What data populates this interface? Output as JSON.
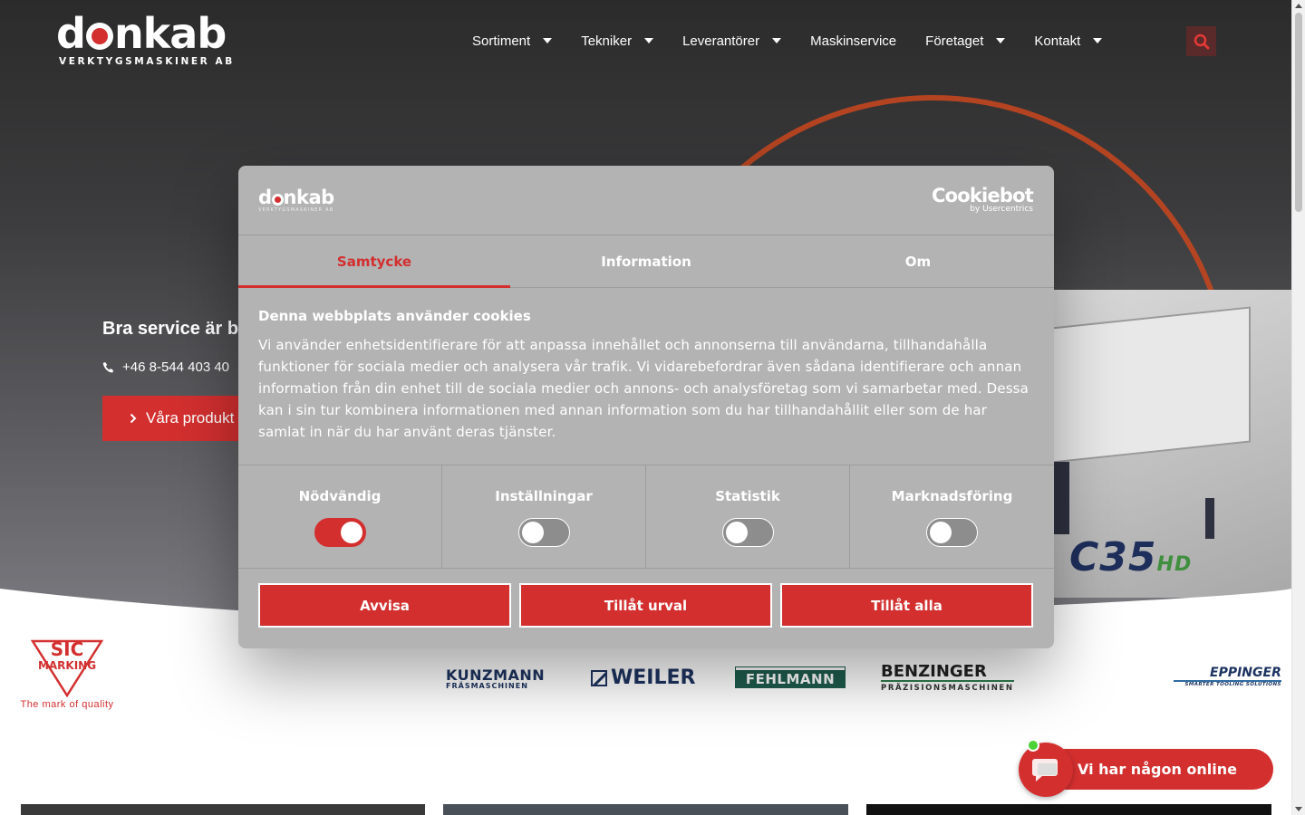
{
  "header": {
    "logo_word_1": "d",
    "logo_word_2": "nkab",
    "logo_subtitle": "VERKTYGSMASKINER AB",
    "nav": [
      {
        "label": "Sortiment",
        "has_dropdown": true
      },
      {
        "label": "Tekniker",
        "has_dropdown": true
      },
      {
        "label": "Leverantörer",
        "has_dropdown": true
      },
      {
        "label": "Maskinservice",
        "has_dropdown": false
      },
      {
        "label": "Företaget",
        "has_dropdown": true
      },
      {
        "label": "Kontakt",
        "has_dropdown": true
      }
    ],
    "search_icon": "search-icon"
  },
  "hero": {
    "title": "Bra service är bra",
    "phone": "+46 8-544 403 40",
    "cta": "Våra produkt",
    "machine_model": "C35",
    "machine_suffix": "HD"
  },
  "brands": {
    "sic_name": "SIC",
    "sic_sub": "MARKING",
    "sic_tagline": "The mark of quality",
    "kunzmann": "KUNZMANN",
    "kunzmann_sub": "FRÄSMASCHINEN",
    "weiler": "WEILER",
    "fehlmann": "FEHLMANN",
    "benzinger": "BENZINGER",
    "benzinger_sub": "PRÄZISIONSMASCHINEN",
    "eppinger": "EPPINGER",
    "eppinger_sub": "SMARTER TOOLING SOLUTIONS"
  },
  "cookie_dialog": {
    "logo_word_1": "d",
    "logo_word_2": "nkab",
    "logo_sub": "VERKTYGSMASKINER AB",
    "provider": "Cookiebot",
    "provider_sub": "by Usercentrics",
    "tabs": [
      "Samtycke",
      "Information",
      "Om"
    ],
    "active_tab": "Samtycke",
    "heading": "Denna webbplats använder cookies",
    "body": "Vi använder enhetsidentifierare för att anpassa innehållet och annonserna till användarna, tillhandahålla funktioner för sociala medier och analysera vår trafik. Vi vidarebefordrar även sådana identifierare och annan information från din enhet till de sociala medier och annons- och analysföretag som vi samarbetar med. Dessa kan i sin tur kombinera informationen med annan information som du har tillhandahållit eller som de har samlat in när du har använt deras tjänster.",
    "categories": [
      {
        "label": "Nödvändig",
        "enabled": true
      },
      {
        "label": "Inställningar",
        "enabled": false
      },
      {
        "label": "Statistik",
        "enabled": false
      },
      {
        "label": "Marknadsföring",
        "enabled": false
      }
    ],
    "buttons": {
      "reject": "Avvisa",
      "allow_selection": "Tillåt urval",
      "allow_all": "Tillåt alla"
    }
  },
  "chat": {
    "label": "Vi har någon online",
    "status_color": "#4cd137"
  },
  "colors": {
    "accent": "#d32f2f",
    "dialog_bg": "#b3b3b3",
    "hero_dark": "#2b2b2b"
  }
}
